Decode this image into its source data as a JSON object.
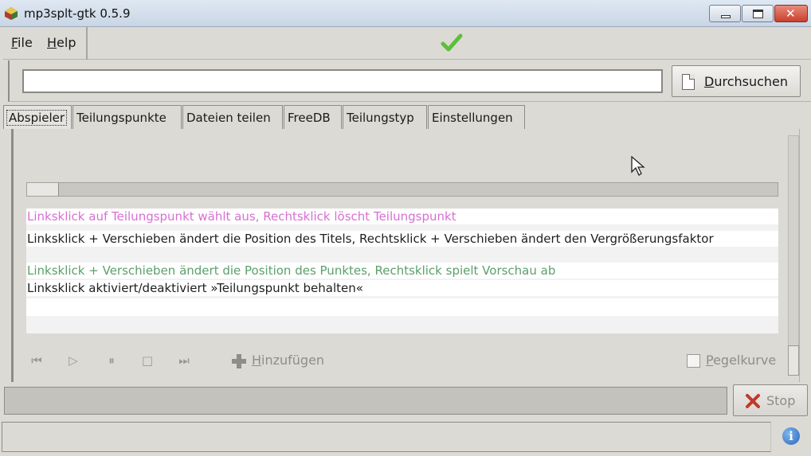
{
  "window": {
    "title": "mp3splt-gtk 0.5.9"
  },
  "menu": {
    "file": "File",
    "help": "Help"
  },
  "search": {
    "value": "",
    "browse_label": "Durchsuchen"
  },
  "tabs": [
    {
      "label": "Abspieler",
      "active": true
    },
    {
      "label": "Teilungspunkte",
      "active": false
    },
    {
      "label": "Dateien teilen",
      "active": false
    },
    {
      "label": "FreeDB",
      "active": false
    },
    {
      "label": "Teilungstyp",
      "active": false
    },
    {
      "label": "Einstellungen",
      "active": false
    }
  ],
  "player": {
    "hints": [
      {
        "text": "Linksklick auf Teilungspunkt wählt aus, Rechtsklick löscht Teilungspunkt",
        "color": "#d86fd3"
      },
      {
        "text": "Linksklick + Verschieben ändert die Position des Titels, Rechtsklick + Verschieben ändert den Vergrößerungsfaktor",
        "color": "#1e1e1e"
      },
      {
        "text": "Linksklick + Verschieben ändert die Position des Punktes, Rechtsklick spielt Vorschau ab",
        "color": "#5ba06a"
      },
      {
        "text": "Linksklick aktiviert/deaktiviert »Teilungspunkt behalten«",
        "color": "#1e1e1e"
      }
    ],
    "controls": {
      "icons": [
        "previous-icon",
        "play-icon",
        "pause-icon",
        "stop-playback-icon",
        "next-icon"
      ],
      "add_label": "Hinzufügen",
      "level_curve_label": "Pegelkurve",
      "level_curve_checked": false
    },
    "position_fraction": 0.0
  },
  "actions": {
    "stop_label": "Stop"
  },
  "status": {
    "text": ""
  },
  "colors": {
    "accent_check": "#5cbf3a",
    "stop_icon": "#c0392b",
    "info": "#2a66b8"
  }
}
